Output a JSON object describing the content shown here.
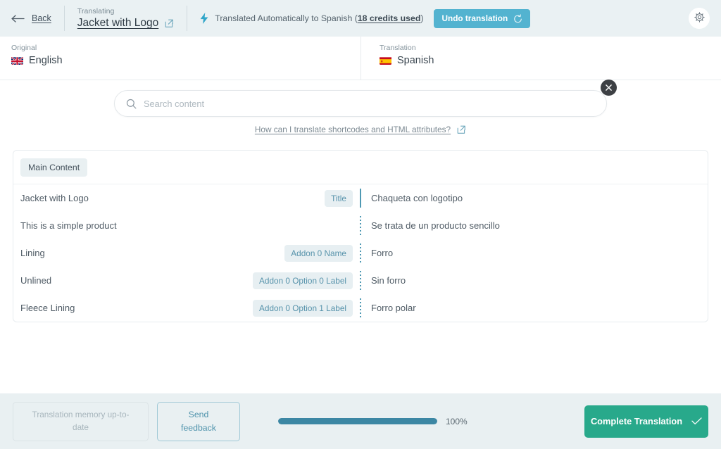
{
  "header": {
    "back_label": "Back",
    "back_icon": "arrow-left-icon",
    "title_eyebrow": "Translating",
    "title": "Jacket with Logo",
    "title_external_icon": "external-link-icon",
    "status_icon": "bolt-icon",
    "status_prefix": "Translated Automatically to Spanish (",
    "status_credits": "18 credits used",
    "status_suffix": ")",
    "undo_label": "Undo translation",
    "undo_icon": "undo-icon",
    "settings_icon": "gear-icon",
    "bg_color": "#eaf1f3",
    "undo_color": "#53b3d0"
  },
  "languages": {
    "source": {
      "eyebrow": "Original",
      "name": "English",
      "flag": "uk-flag"
    },
    "target": {
      "eyebrow": "Translation",
      "name": "Spanish",
      "flag": "spain-flag"
    }
  },
  "search": {
    "placeholder": "Search content",
    "value": "",
    "icon": "search-icon",
    "close_icon": "close-icon",
    "help_link": "How can I translate shortcodes and HTML attributes?",
    "help_icon": "external-link-icon"
  },
  "content": {
    "tab_label": "Main Content",
    "rows": [
      {
        "source": "Jacket with Logo",
        "chip": "Title",
        "target": "Chaqueta con logotipo",
        "separator": "solid"
      },
      {
        "source": "This is a simple product",
        "chip": "",
        "target": "Se trata de un producto sencillo",
        "separator": "dotted"
      },
      {
        "source": "Lining",
        "chip": "Addon 0 Name",
        "target": "Forro",
        "separator": "dotted"
      },
      {
        "source": "Unlined",
        "chip": "Addon 0 Option 0 Label",
        "target": "Sin forro",
        "separator": "dotted"
      },
      {
        "source": "Fleece Lining",
        "chip": "Addon 0 Option 1 Label",
        "target": "Forro polar",
        "separator": "dotted"
      }
    ]
  },
  "footer": {
    "tm_label": "Translation memory up-to-date",
    "feedback_label_line1": "Send",
    "feedback_label_line2": "feedback",
    "progress_percent": 100,
    "progress_label": "100%",
    "complete_label": "Complete Translation",
    "complete_icon": "check-icon",
    "complete_color": "#28a98b",
    "progress_color": "#3c87a4"
  }
}
